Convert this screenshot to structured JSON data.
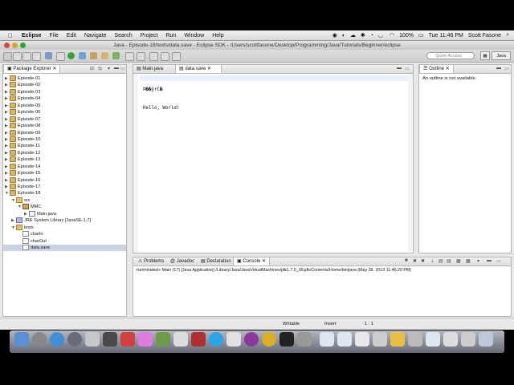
{
  "menubar": {
    "apple": "",
    "items": [
      "Eclipse",
      "File",
      "Edit",
      "Navigate",
      "Search",
      "Project",
      "Run",
      "Window",
      "Help"
    ],
    "battery": "100%",
    "clock": "Tue 11:46 PM",
    "user": "Scott Fasone"
  },
  "window": {
    "title": "Java - Episode-18/texts/data.save - Eclipse SDK - /Users/scottfasone/Desktop/Programming/Java/Tutorials/Beginner/eclipse"
  },
  "toolbar": {
    "quick_access_placeholder": "Quick Access",
    "perspective": "Java"
  },
  "package_explorer": {
    "tab": "Package Explorer",
    "tree": [
      {
        "label": "Episode-01",
        "depth": 0,
        "icon": "proj",
        "arrow": "▶"
      },
      {
        "label": "Episode-02",
        "depth": 0,
        "icon": "proj",
        "arrow": "▶"
      },
      {
        "label": "Episode-03",
        "depth": 0,
        "icon": "proj",
        "arrow": "▶"
      },
      {
        "label": "Episode-04",
        "depth": 0,
        "icon": "proj",
        "arrow": "▶"
      },
      {
        "label": "Episode-05",
        "depth": 0,
        "icon": "proj",
        "arrow": "▶"
      },
      {
        "label": "Episode-06",
        "depth": 0,
        "icon": "proj",
        "arrow": "▶"
      },
      {
        "label": "Episode-07",
        "depth": 0,
        "icon": "proj",
        "arrow": "▶"
      },
      {
        "label": "Episode-08",
        "depth": 0,
        "icon": "proj",
        "arrow": "▶"
      },
      {
        "label": "Episode-09",
        "depth": 0,
        "icon": "proj",
        "arrow": "▶"
      },
      {
        "label": "Episode-10",
        "depth": 0,
        "icon": "proj",
        "arrow": "▶"
      },
      {
        "label": "Episode-11",
        "depth": 0,
        "icon": "proj",
        "arrow": "▶"
      },
      {
        "label": "Episode-12",
        "depth": 0,
        "icon": "proj",
        "arrow": "▶"
      },
      {
        "label": "Episode-13",
        "depth": 0,
        "icon": "proj",
        "arrow": "▶"
      },
      {
        "label": "Episode-14",
        "depth": 0,
        "icon": "proj",
        "arrow": "▶"
      },
      {
        "label": "Episode-15",
        "depth": 0,
        "icon": "proj",
        "arrow": "▶"
      },
      {
        "label": "Episode-16",
        "depth": 0,
        "icon": "proj",
        "arrow": "▶"
      },
      {
        "label": "Episode-17",
        "depth": 0,
        "icon": "proj",
        "arrow": "▶"
      },
      {
        "label": "Episode-18",
        "depth": 0,
        "icon": "proj",
        "arrow": "▼"
      },
      {
        "label": "src",
        "depth": 1,
        "icon": "fold",
        "arrow": "▼"
      },
      {
        "label": "MMC",
        "depth": 2,
        "icon": "pkg",
        "arrow": "▼"
      },
      {
        "label": "Main.java",
        "depth": 3,
        "icon": "java",
        "arrow": "▶"
      },
      {
        "label": "JRE System Library [JavaSE-1.7]",
        "depth": 1,
        "icon": "jar",
        "arrow": "▶"
      },
      {
        "label": "texts",
        "depth": 1,
        "icon": "fold",
        "arrow": "▼"
      },
      {
        "label": "charIn",
        "depth": 2,
        "icon": "file",
        "arrow": ""
      },
      {
        "label": "charOut",
        "depth": 2,
        "icon": "file",
        "arrow": ""
      },
      {
        "label": "data.save",
        "depth": 2,
        "icon": "file",
        "arrow": "",
        "selected": true
      }
    ]
  },
  "editor": {
    "tabs": [
      {
        "label": "Main.java",
        "active": false
      },
      {
        "label": "data.save",
        "active": true
      }
    ],
    "lines": [
      "Þ��ÿrC�",
      "Hello, World!"
    ]
  },
  "outline": {
    "tab": "Outline",
    "message": "An outline is not available."
  },
  "bottom_panel": {
    "tabs": [
      {
        "label": "Problems",
        "active": false
      },
      {
        "label": "Javadoc",
        "active": false
      },
      {
        "label": "Declaration",
        "active": false
      },
      {
        "label": "Console",
        "active": true
      }
    ],
    "console_line": "<terminated> Main (17) [Java Application] /Library/Java/JavaVirtualMachines/jdk1.7.0_09.jdk/Contents/Home/bin/java (May 28, 2013 11:46:20 PM)"
  },
  "statusbar": {
    "writable": "Writable",
    "insert": "Insert",
    "position": "1 : 1"
  },
  "colors": {
    "selection": "#c8d4e6",
    "close_red": "#e0443e",
    "min_yellow": "#dea123",
    "max_green": "#1aab29"
  }
}
